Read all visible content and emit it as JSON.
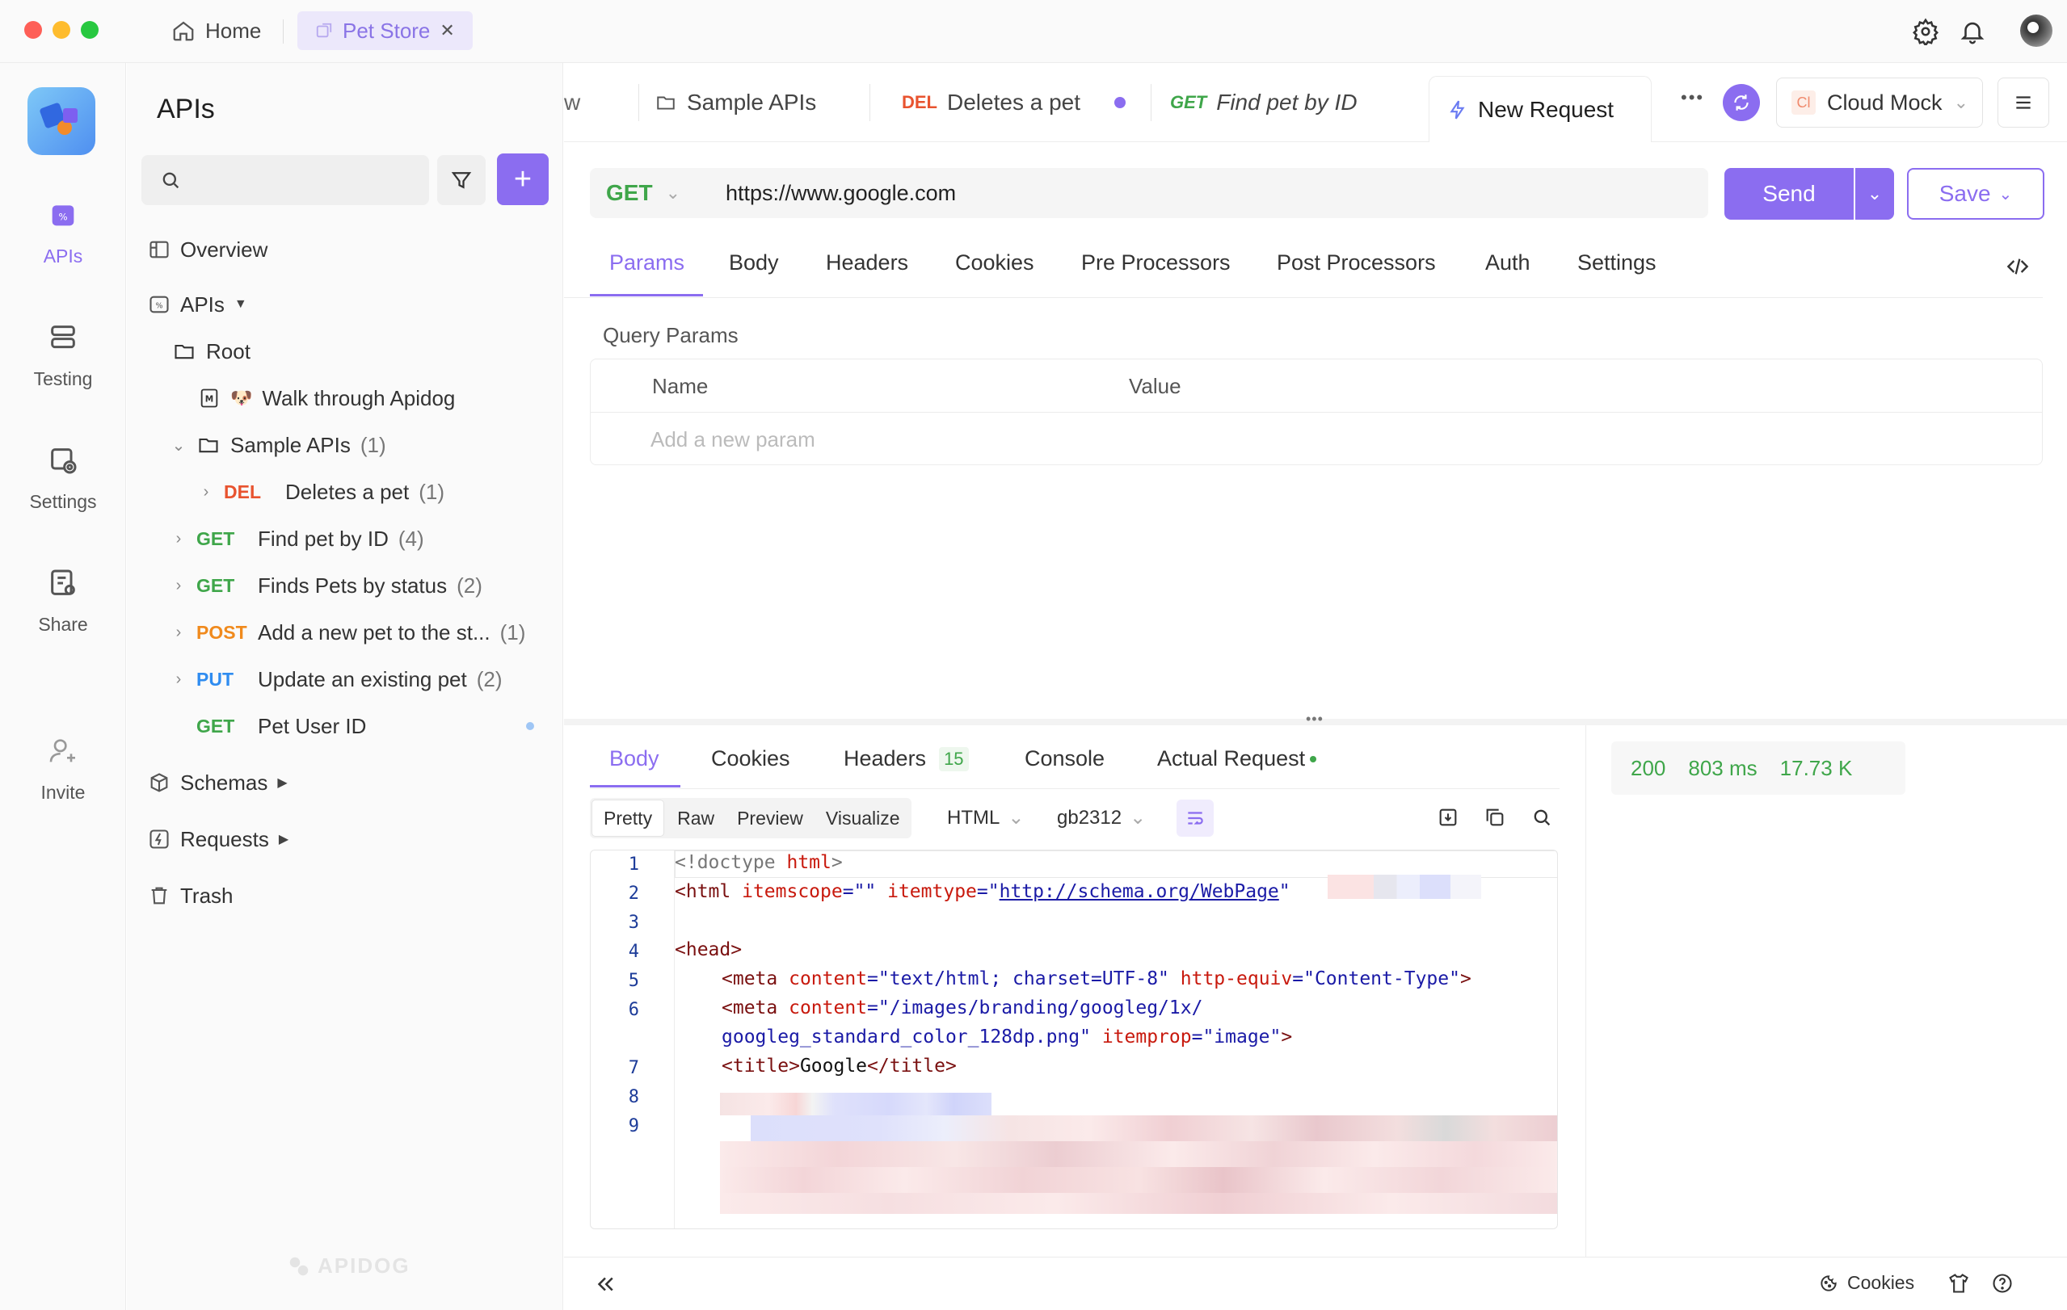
{
  "titlebar": {
    "home_label": "Home",
    "project_tab": "Pet Store",
    "close_glyph": "✕"
  },
  "rail": {
    "items": [
      {
        "label": "APIs",
        "icon": "apis-icon",
        "active": true
      },
      {
        "label": "Testing",
        "icon": "testing-icon"
      },
      {
        "label": "Settings",
        "icon": "settings-icon"
      },
      {
        "label": "Share",
        "icon": "share-icon"
      },
      {
        "label": "Invite",
        "icon": "invite-icon"
      }
    ]
  },
  "sidebar": {
    "title": "APIs",
    "overview": "Overview",
    "apis": "APIs",
    "root": "Root",
    "walkthrough": "Walk through Apidog",
    "sample_apis": "Sample APIs",
    "sample_count": "(1)",
    "endpoints": [
      {
        "method": "DEL",
        "name": "Deletes a pet",
        "count": "(1)"
      },
      {
        "method": "GET",
        "name": "Find pet by ID",
        "count": "(4)"
      },
      {
        "method": "GET",
        "name": "Finds Pets by status",
        "count": "(2)"
      },
      {
        "method": "POST",
        "name": "Add a new pet to the st...",
        "count": "(1)"
      },
      {
        "method": "PUT",
        "name": "Update an existing pet",
        "count": "(2)"
      },
      {
        "method": "GET",
        "name": "Pet User ID",
        "count": ""
      }
    ],
    "schemas": "Schemas",
    "requests": "Requests",
    "trash": "Trash",
    "watermark": "APIDOG"
  },
  "tabs": {
    "partial": "w",
    "sample_apis": "Sample APIs",
    "del_method": "DEL",
    "del_name": "Deletes a pet",
    "get_method": "GET",
    "get_name": "Find pet by ID",
    "new_request": "New Request",
    "more": "•••",
    "env_badge": "Cl",
    "env_name": "Cloud Mock"
  },
  "request": {
    "method": "GET",
    "url": "https://www.google.com",
    "send": "Send",
    "save": "Save",
    "tabs": [
      "Params",
      "Body",
      "Headers",
      "Cookies",
      "Pre Processors",
      "Post Processors",
      "Auth",
      "Settings"
    ],
    "query_params_title": "Query Params",
    "col_name": "Name",
    "col_value": "Value",
    "add_param": "Add a new param"
  },
  "response": {
    "tabs": {
      "body": "Body",
      "cookies": "Cookies",
      "headers": "Headers",
      "headers_count": "15",
      "console": "Console",
      "actual": "Actual Request"
    },
    "formats": [
      "Pretty",
      "Raw",
      "Preview",
      "Visualize"
    ],
    "lang": "HTML",
    "charset": "gb2312",
    "status": "200",
    "time": "803 ms",
    "size": "17.73 K"
  },
  "code": {
    "l1_a": "<!doctype ",
    "l1_b": "html",
    "l1_c": ">",
    "l2_tag": "<html ",
    "l2_attr1": "itemscope",
    "l2_eq1": "=\"\" ",
    "l2_attr2": "itemtype",
    "l2_eq2": "=\"",
    "l2_link": "http://schema.org/WebPage",
    "l2_end": "\"",
    "l4": "<head>",
    "l5_tag": "<meta ",
    "l5_a1": "content",
    "l5_v1": "=\"text/html; charset=UTF-8\" ",
    "l5_a2": "http-equiv",
    "l5_v2": "=\"Content-Type\"",
    "l5_end": ">",
    "l6_tag": "<meta ",
    "l6_a1": "content",
    "l6_v1": "=\"/images/branding/googleg/1x/",
    "l6b_v": "googleg_standard_color_128dp.png\" ",
    "l6b_a": "itemprop",
    "l6b_v2": "=\"image\"",
    "l6b_end": ">",
    "l7_open": "<title>",
    "l7_text": "Google",
    "l7_close": "</title>"
  },
  "footer": {
    "cookies": "Cookies"
  },
  "colors": {
    "accent": "#8b6df0",
    "get": "#3fa64a",
    "del": "#e8532f",
    "post": "#f08a1d",
    "put": "#2f8cf0"
  }
}
